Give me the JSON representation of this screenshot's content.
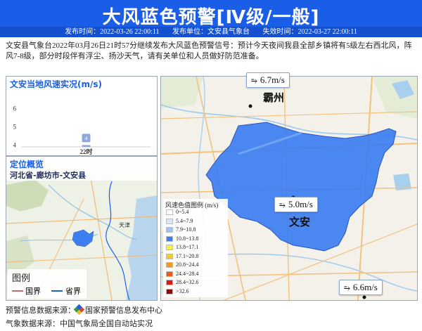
{
  "header": {
    "title": "大风蓝色预警[Ⅳ级/一般]",
    "publish_time": "发布时间：2022-03-26 22:00:11",
    "publisher": "发布单位：文安县气象台",
    "expire_time": "失效时间：2022-03-27 22:00:11"
  },
  "description": "文安县气象台2022年03月26日21时57分继续发布大风蓝色预警信号：预计今天夜间我县全部乡镇将有5级左右西北风，阵风7-8级，部分时段伴有浮尘、扬沙天气，请有关单位和人员做好防范准备。",
  "wind_panel": {
    "title": "文安当地风速实况(m/s)"
  },
  "chart_data": {
    "type": "bar",
    "categories": [
      "22时"
    ],
    "values": [
      4
    ],
    "data_labels": [
      "4"
    ],
    "yticks": [
      "6",
      "5",
      "4"
    ],
    "ylim": [
      3.9,
      6.6
    ],
    "title": "文安当地风速实况(m/s)",
    "bar_color": "#8fa8d8"
  },
  "location_panel": {
    "title": "定位概览",
    "subtitle": "河北省-廊坊市-文安县",
    "place_tianjin": "天津",
    "legend_title": "图例",
    "legend_border_country": "国界",
    "legend_border_province": "省界"
  },
  "map": {
    "city_bazhou": "霸州",
    "county_wenan": "文安",
    "callouts": [
      {
        "name": "callout-bazhou",
        "text": "6.7m/s"
      },
      {
        "name": "callout-wenan",
        "text": "5.0m/s"
      },
      {
        "name": "callout-southeast",
        "text": "6.6m/s"
      }
    ],
    "wind_glyph": "⥱",
    "region_color": "#3d7ef0"
  },
  "legend": {
    "title": "风速色值图例 (m/s)",
    "items": [
      {
        "label": "0~5.4",
        "color": "#ffffff"
      },
      {
        "label": "5.4~7.9",
        "color": "#d6e6fb"
      },
      {
        "label": "7.9~10.8",
        "color": "#9cc4f5"
      },
      {
        "label": "10.8~13.8",
        "color": "#3d7ef0"
      },
      {
        "label": "13.8~17.1",
        "color": "#f6f24a"
      },
      {
        "label": "17.1~20.8",
        "color": "#f7c82e"
      },
      {
        "label": "20.8~24.4",
        "color": "#f59a1e"
      },
      {
        "label": "24.4~28.4",
        "color": "#ef5a13"
      },
      {
        "label": "28.4~32.6",
        "color": "#d4200d"
      },
      {
        "label": ">32.6",
        "color": "#8b0a08"
      }
    ]
  },
  "footer": {
    "warning_source_label": "预警信息数据来源：",
    "warning_source": "国家预警信息发布中心",
    "weather_source": "气象数据来源：中国气象局全国自动站实况"
  }
}
